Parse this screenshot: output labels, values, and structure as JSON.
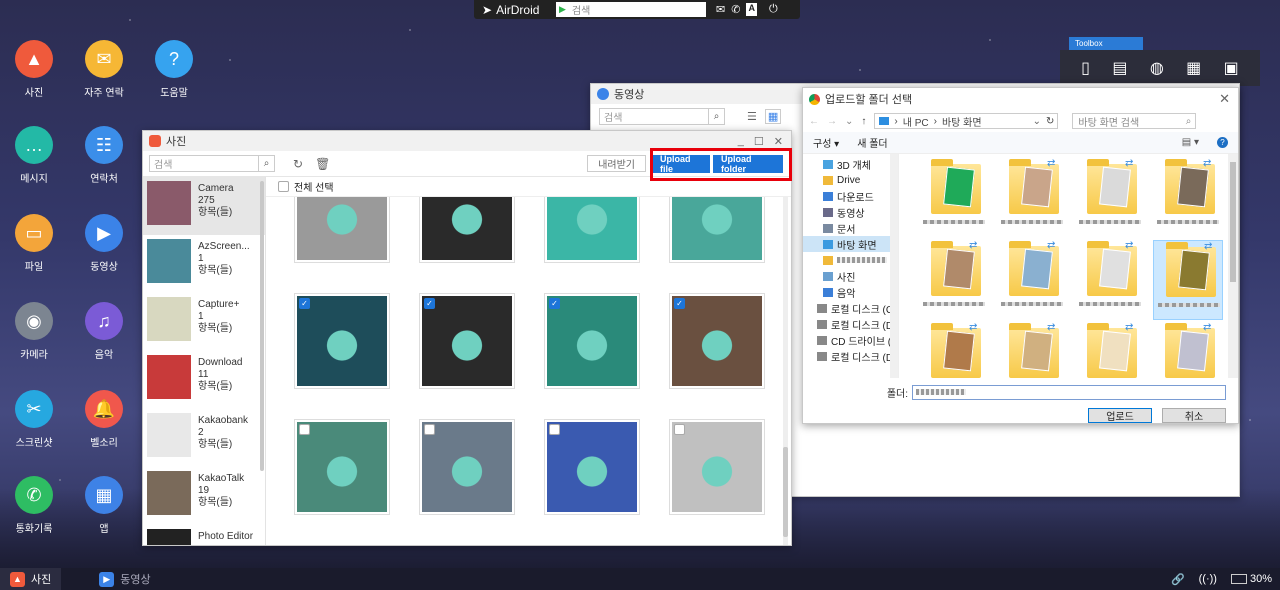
{
  "topbar": {
    "logo": "AirDroid",
    "search_placeholder": "검색"
  },
  "desktop_icons": [
    {
      "label": "사진",
      "icon": "photo-icon",
      "color": "#ef5a3c"
    },
    {
      "label": "자주 연락",
      "icon": "frequent-contact-icon",
      "color": "#f6b735"
    },
    {
      "label": "도움말",
      "icon": "help-icon",
      "color": "#36a3ef"
    },
    {
      "label": "메시지",
      "icon": "message-icon",
      "color": "#23b9a6"
    },
    {
      "label": "연락처",
      "icon": "contacts-icon",
      "color": "#3b8ee9"
    },
    {
      "label": "파일",
      "icon": "folder-icon",
      "color": "#f3a53a"
    },
    {
      "label": "동영상",
      "icon": "video-icon",
      "color": "#3b83e8"
    },
    {
      "label": "카메라",
      "icon": "camera-icon",
      "color": "#7c8591"
    },
    {
      "label": "음악",
      "icon": "music-icon",
      "color": "#7b5bd6"
    },
    {
      "label": "스크린샷",
      "icon": "screenshot-icon",
      "color": "#26a8e0"
    },
    {
      "label": "벨소리",
      "icon": "bell-icon",
      "color": "#f0574c"
    },
    {
      "label": "통화기록",
      "icon": "call-log-icon",
      "color": "#2ebd63"
    },
    {
      "label": "앱",
      "icon": "apps-icon",
      "color": "#3e82e6"
    }
  ],
  "toolbox": {
    "label": "Toolbox"
  },
  "video_window": {
    "title": "동영상",
    "search_placeholder": "검색"
  },
  "photo_window": {
    "title": "사진",
    "search_placeholder": "검색",
    "download_label": "내려받기",
    "upload_file_label": "Upload file",
    "upload_folder_label": "Upload folder",
    "select_all_label": "전체 선택",
    "albums": [
      {
        "name": "Camera",
        "count": "275",
        "unit": "항목(들)"
      },
      {
        "name": "AzScreen...",
        "count": "1",
        "unit": "항목(들)"
      },
      {
        "name": "Capture+",
        "count": "1",
        "unit": "항목(들)"
      },
      {
        "name": "Download",
        "count": "11",
        "unit": "항목(들)"
      },
      {
        "name": "Kakaobank",
        "count": "2",
        "unit": "항목(들)"
      },
      {
        "name": "KakaoTalk",
        "count": "19",
        "unit": "항목(들)"
      },
      {
        "name": "Photo Editor",
        "count": "",
        "unit": ""
      }
    ]
  },
  "dialog": {
    "title": "업로드할 폴더 선택",
    "path": [
      "내 PC",
      "바탕 화면"
    ],
    "search_placeholder": "바탕 화면 검색",
    "organize_label": "구성",
    "new_folder_label": "새 폴더",
    "tree": [
      {
        "label": "3D 개체",
        "color": "#4aa3e0"
      },
      {
        "label": "Drive",
        "color": "#f0b93a"
      },
      {
        "label": "다운로드",
        "color": "#3b7fd8"
      },
      {
        "label": "동영상",
        "color": "#6a6a8a"
      },
      {
        "label": "문서",
        "color": "#7a8aa0"
      },
      {
        "label": "바탕 화면",
        "color": "#3b9ae0"
      },
      {
        "label": "",
        "color": "#f0b93a"
      },
      {
        "label": "사진",
        "color": "#6aa0d0"
      },
      {
        "label": "음악",
        "color": "#3b7fd8"
      },
      {
        "label": "로컬 디스크 (C:)",
        "color": "#888"
      },
      {
        "label": "로컬 디스크 (D:)",
        "color": "#888"
      },
      {
        "label": "CD 드라이브 (E:)",
        "color": "#888"
      },
      {
        "label": "로컬 디스크 (D:)",
        "color": "#888"
      }
    ],
    "folder_label": "폴더:",
    "upload_label": "업로드",
    "cancel_label": "취소"
  },
  "taskbar": {
    "items": [
      {
        "label": "사진",
        "color": "#ef5a3c"
      },
      {
        "label": "동영상",
        "color": "#3b83e8"
      }
    ],
    "battery": "30%"
  }
}
